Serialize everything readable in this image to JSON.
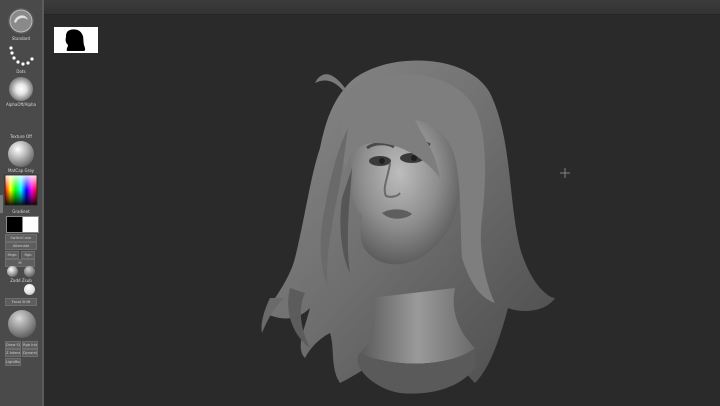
{
  "shelf": {
    "brush_label": "Standard",
    "stroke_label": "Dots",
    "alpha_label": "AlphaOff/Alpha",
    "texture_label": "Texture Off",
    "material_label": "MatCap Gray",
    "gradient_label": "Gradient",
    "switch_color_label": "SwitchColor",
    "alternate_label": "Alternate",
    "mrgb_label": "Mrgb",
    "rgb_label": "Rgb",
    "m_label": "M",
    "zadd_label": "Zadd",
    "zsub_label": "Zsub",
    "zcut_label": "Zcut",
    "focal_label": "Focal Shift",
    "draw_size_label": "Draw Size",
    "rgb_intensity_label": "Rgb Intensity",
    "z_intensity_label": "Z Intensity",
    "dynamic_label": "Dynamic",
    "lightbox_label": "LightBox",
    "edit_label": "Edit",
    "move_label": "Move",
    "scale_label": "Scale",
    "rotate_label": "Rotate"
  },
  "colors": {
    "primary": "#000000",
    "secondary": "#ffffff"
  },
  "icons": [
    "brush-sphere-icon",
    "stroke-dots-icon",
    "alpha-icon",
    "material-sphere-icon",
    "color-picker",
    "navigation-sphere-icon",
    "cursor-crosshair-icon"
  ]
}
